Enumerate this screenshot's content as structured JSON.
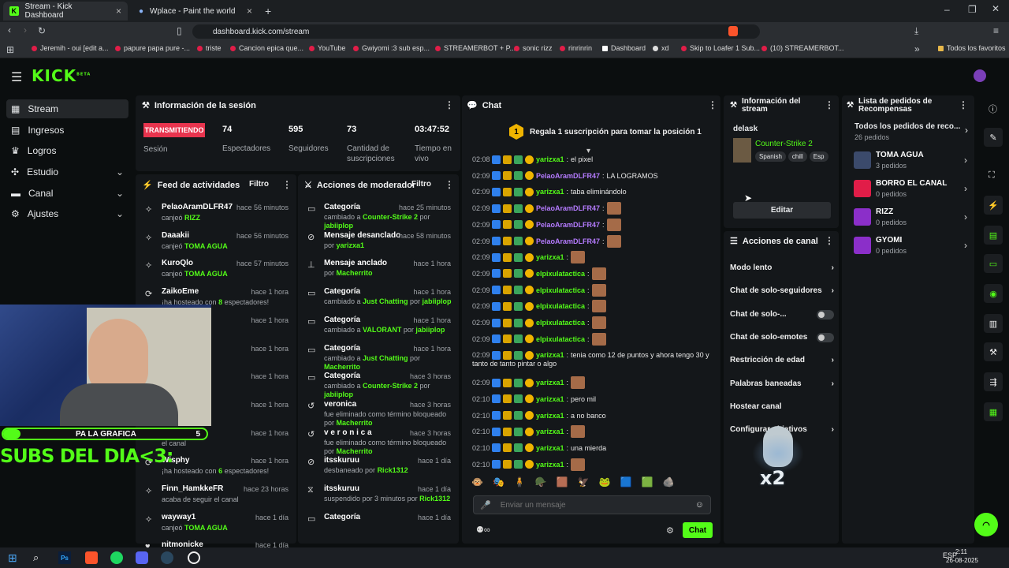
{
  "browser": {
    "tabs": [
      {
        "label": "Stream - Kick Dashboard"
      },
      {
        "label": "Wplace - Paint the world"
      }
    ],
    "url": "dashboard.kick.com/stream"
  },
  "bookmarks": [
    "Jeremih - oui [edit a...",
    "papure papa pure -...",
    "triste",
    "Cancion epica que...",
    "YouTube",
    "Gwiyomi :3 sub esp...",
    "STREAMERBOT + P...",
    "sonic rizz",
    "rinrinrin",
    "Dashboard",
    "xd",
    "Skip to Loafer 1 Sub...",
    "(10) STREAMERBOT...",
    "Todos los favoritos"
  ],
  "brand": {
    "logo": "KICK",
    "beta": "BETA",
    "accent": "#53fc18"
  },
  "sidebar": {
    "items": [
      {
        "label": "Stream"
      },
      {
        "label": "Ingresos"
      },
      {
        "label": "Logros"
      },
      {
        "label": "Estudio"
      },
      {
        "label": "Canal"
      },
      {
        "label": "Ajustes"
      }
    ]
  },
  "session": {
    "title": "Información de la sesión",
    "live_label": "TRANSMITIENDO",
    "session_label": "Sesión",
    "stats": [
      {
        "value": "74",
        "label": "Espectadores"
      },
      {
        "value": "595",
        "label": "Seguidores"
      },
      {
        "value": "73",
        "label": "Cantidad de suscripciones"
      },
      {
        "value": "03:47:52",
        "label": "Tiempo en vivo"
      }
    ]
  },
  "feed": {
    "title": "Feed de actividades",
    "filter": "Filtro",
    "items": [
      {
        "name": "PelaoAramDLFR47",
        "time": "hace 56 minutos",
        "pre": "canjeó ",
        "hl": "RIZZ",
        "post": ""
      },
      {
        "name": "Daaakii",
        "time": "hace 56 minutos",
        "pre": "canjeó ",
        "hl": "TOMA AGUA",
        "post": ""
      },
      {
        "name": "KuroQlo",
        "time": "hace 57 minutos",
        "pre": "canjeó ",
        "hl": "TOMA AGUA",
        "post": ""
      },
      {
        "name": "ZaikoEme",
        "time": "hace 1 hora",
        "pre": "¡ha hosteado con ",
        "hl": "8",
        "post": " espectadores!"
      },
      {
        "name": "",
        "time": "hace 1 hora",
        "pre": "el canal",
        "hl": "",
        "post": ""
      },
      {
        "name": "",
        "time": "hace 1 hora",
        "pre": "",
        "hl": "UA",
        "post": ""
      },
      {
        "name": "",
        "time": "hace 1 hora",
        "pre": "el canal",
        "hl": "",
        "post": ""
      },
      {
        "name": "",
        "time": "hace 1 hora",
        "pre": "el canal",
        "hl": "",
        "post": ""
      },
      {
        "name": "",
        "time": "hace 1 hora",
        "pre": "el canal",
        "hl": "",
        "post": ""
      },
      {
        "name": "Wisphy",
        "time": "hace 1 hora",
        "pre": "¡ha hosteado con ",
        "hl": "6",
        "post": " espectadores!"
      },
      {
        "name": "Finn_HamkkeFR",
        "time": "hace 23 horas",
        "pre": "acaba de seguir el canal",
        "hl": "",
        "post": ""
      },
      {
        "name": "wayway1",
        "time": "hace 1 día",
        "pre": "canjeó ",
        "hl": "TOMA AGUA",
        "post": ""
      },
      {
        "name": "nitmonicke",
        "time": "hace 1 día",
        "pre": "acaba de seguir el canal",
        "hl": "",
        "post": ""
      }
    ]
  },
  "mod": {
    "title": "Acciones de moderador",
    "filter": "Filtro",
    "items": [
      {
        "name": "Categoría",
        "time": "hace 25 minutos",
        "pre": "cambiado a ",
        "hl": "Counter-Strike 2",
        "mid": " por ",
        "by": "jabiiplop"
      },
      {
        "name": "Mensaje desanclado",
        "time": "hace 58 minutos",
        "pre": "por ",
        "hl": "",
        "mid": "",
        "by": "yarizxa1"
      },
      {
        "name": "Mensaje anclado",
        "time": "hace 1 hora",
        "pre": "por ",
        "hl": "",
        "mid": "",
        "by": "Macherrito"
      },
      {
        "name": "Categoría",
        "time": "hace 1 hora",
        "pre": "cambiado a ",
        "hl": "Just Chatting",
        "mid": " por ",
        "by": "jabiiplop"
      },
      {
        "name": "Categoría",
        "time": "hace 1 hora",
        "pre": "cambiado a ",
        "hl": "VALORANT",
        "mid": " por ",
        "by": "jabiiplop"
      },
      {
        "name": "Categoría",
        "time": "hace 1 hora",
        "pre": "cambiado a ",
        "hl": "Just Chatting",
        "mid": " por ",
        "by": "Macherrito"
      },
      {
        "name": "Categoría",
        "time": "hace 3 horas",
        "pre": "cambiado a ",
        "hl": "Counter-Strike 2",
        "mid": " por ",
        "by": "jabiiplop"
      },
      {
        "name": "veronica",
        "time": "hace 3 horas",
        "pre": "fue eliminado como término bloqueado por ",
        "hl": "",
        "mid": "",
        "by": "Macherrito"
      },
      {
        "name": "v e r o n i c a",
        "time": "hace 3 horas",
        "pre": "fue eliminado como término bloqueado por ",
        "hl": "",
        "mid": "",
        "by": "Macherrito"
      },
      {
        "name": "itsskuruu",
        "time": "hace 1 día",
        "pre": "desbaneado por ",
        "hl": "",
        "mid": "",
        "by": "Rick1312"
      },
      {
        "name": "itsskuruu",
        "time": "hace 1 día",
        "pre": "suspendido por 3 minutos por ",
        "hl": "",
        "mid": "",
        "by": "Rick1312"
      },
      {
        "name": "Categoría",
        "time": "hace 1 día",
        "pre": "",
        "hl": "",
        "mid": "",
        "by": ""
      }
    ]
  },
  "chat": {
    "title": "Chat",
    "gift_rank": "1",
    "gift_text": "Regala 1 suscripción para tomar la posición 1",
    "input_placeholder": "Enviar un mensaje",
    "send": "Chat",
    "messages": [
      {
        "time": "02:08",
        "user": "yarizxa1",
        "color": "#53fc18",
        "text": "el pixel",
        "emote": false
      },
      {
        "time": "02:09",
        "user": "PelaoAramDLFR47",
        "color": "#b57bff",
        "text": "LA LOGRAMOS",
        "emote": false
      },
      {
        "time": "02:09",
        "user": "yarizxa1",
        "color": "#53fc18",
        "text": "taba eliminándolo",
        "emote": false
      },
      {
        "time": "02:09",
        "user": "PelaoAramDLFR47",
        "color": "#b57bff",
        "text": "",
        "emote": true
      },
      {
        "time": "02:09",
        "user": "PelaoAramDLFR47",
        "color": "#b57bff",
        "text": "",
        "emote": true
      },
      {
        "time": "02:09",
        "user": "PelaoAramDLFR47",
        "color": "#b57bff",
        "text": "",
        "emote": true
      },
      {
        "time": "02:09",
        "user": "yarizxa1",
        "color": "#53fc18",
        "text": "",
        "emote": true
      },
      {
        "time": "02:09",
        "user": "elpixulatactica",
        "color": "#53fc18",
        "text": "",
        "emote": true
      },
      {
        "time": "02:09",
        "user": "elpixulatactica",
        "color": "#53fc18",
        "text": "",
        "emote": true
      },
      {
        "time": "02:09",
        "user": "elpixulatactica",
        "color": "#53fc18",
        "text": "",
        "emote": true
      },
      {
        "time": "02:09",
        "user": "elpixulatactica",
        "color": "#53fc18",
        "text": "",
        "emote": true
      },
      {
        "time": "02:09",
        "user": "elpixulatactica",
        "color": "#53fc18",
        "text": "",
        "emote": true
      },
      {
        "time": "02:09",
        "user": "yarizxa1",
        "color": "#53fc18",
        "text": "tenia como 12 de puntos y ahora tengo 30 y",
        "text2": "tanto de tanto pintar o algo",
        "emote": false
      },
      {
        "time": "02:09",
        "user": "yarizxa1",
        "color": "#53fc18",
        "text": "",
        "emote": true
      },
      {
        "time": "02:10",
        "user": "yarizxa1",
        "color": "#53fc18",
        "text": "pero mil",
        "emote": false
      },
      {
        "time": "02:10",
        "user": "yarizxa1",
        "color": "#53fc18",
        "text": "a no banco",
        "emote": false
      },
      {
        "time": "02:10",
        "user": "yarizxa1",
        "color": "#53fc18",
        "text": "",
        "emote": true
      },
      {
        "time": "02:10",
        "user": "yarizxa1",
        "color": "#53fc18",
        "text": "una mierda",
        "emote": false
      },
      {
        "time": "02:10",
        "user": "yarizxa1",
        "color": "#53fc18",
        "text": "",
        "emote": true
      }
    ]
  },
  "streaminfo": {
    "title": "Información del stream",
    "streamer": "delask",
    "category": "Counter-Strike 2",
    "tags": [
      "Spanish",
      "chill",
      "Esp"
    ],
    "edit": "Editar"
  },
  "channel_actions": {
    "title": "Acciones de canal",
    "items": [
      {
        "label": "Modo lento",
        "type": "chev"
      },
      {
        "label": "Chat de solo-seguidores",
        "type": "chev"
      },
      {
        "label": "Chat de solo-...",
        "type": "toggle"
      },
      {
        "label": "Chat de solo-emotes",
        "type": "toggle"
      },
      {
        "label": "Restricción de edad",
        "type": "chev"
      },
      {
        "label": "Palabras baneadas",
        "type": "chev"
      },
      {
        "label": "Hostear canal",
        "type": "none"
      },
      {
        "label": "Configurar objetivos",
        "type": "chev"
      }
    ]
  },
  "rewards": {
    "title": "Lista de pedidos de Recompensas",
    "all_label": "Todos los pedidos de reco...",
    "all_count": "26 pedidos",
    "items": [
      {
        "name": "TOMA AGUA",
        "count": "3 pedidos",
        "color": "#3b4a6b"
      },
      {
        "name": "BORRO EL CANAL",
        "count": "0 pedidos",
        "color": "#e11d48"
      },
      {
        "name": "RIZZ",
        "count": "0 pedidos",
        "color": "#8b2fc9"
      },
      {
        "name": "GYOMI",
        "count": "0 pedidos",
        "color": "#8b2fc9"
      }
    ]
  },
  "overlay": {
    "goal_label": "PA LA GRAFICA",
    "goal_count": "5",
    "subs_text": "SUBS DEL DIA<3:",
    "sticker": "x2"
  },
  "taskbar": {
    "time": "2:11",
    "date": "26-08-2025",
    "lang": "ESP"
  }
}
